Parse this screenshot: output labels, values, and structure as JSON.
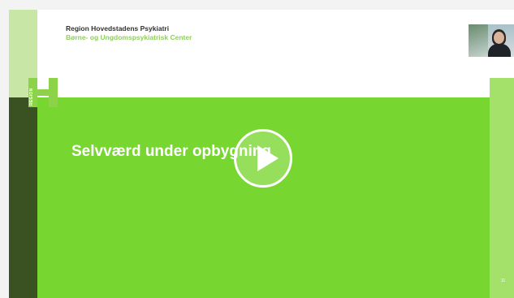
{
  "slide": {
    "org_name": "Region Hovedstadens Psykiatri",
    "org_subtitle": "Børne- og Ungdomspsykiatrisk Center",
    "logo_text": "REGION",
    "title": "Selvværd under opbygning",
    "page_number": "11"
  },
  "player": {
    "play_icon": "play-icon",
    "presenter_icon": "presenter-video-thumbnail"
  },
  "colors": {
    "primary_green": "#78d630",
    "dark_green": "#3a5222",
    "light_green": "#a3e16a",
    "accent_green_text": "#8fcf5a"
  }
}
